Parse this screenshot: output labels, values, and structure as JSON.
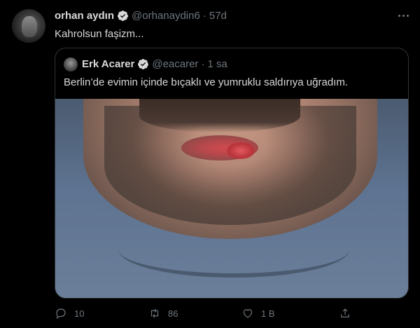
{
  "tweet": {
    "author_name": "orhan aydın",
    "author_handle": "@orhanaydin6",
    "separator": "·",
    "time": "57d",
    "text": "Kahrolsun faşizm...",
    "verified": true
  },
  "quote": {
    "author_name": "Erk Acarer",
    "author_handle": "@eacarer",
    "separator": "·",
    "time": "1 sa",
    "text": "Berlin’de evimin içinde bıçaklı ve yumruklu saldırıya uğradım.",
    "verified": true
  },
  "actions": {
    "reply_count": "10",
    "retweet_count": "86",
    "like_count": "1 B"
  },
  "colors": {
    "background": "#000000",
    "text": "#d9d9d9",
    "muted": "#6e767d",
    "verified": "#d9d9d9",
    "border": "#2f3336"
  }
}
